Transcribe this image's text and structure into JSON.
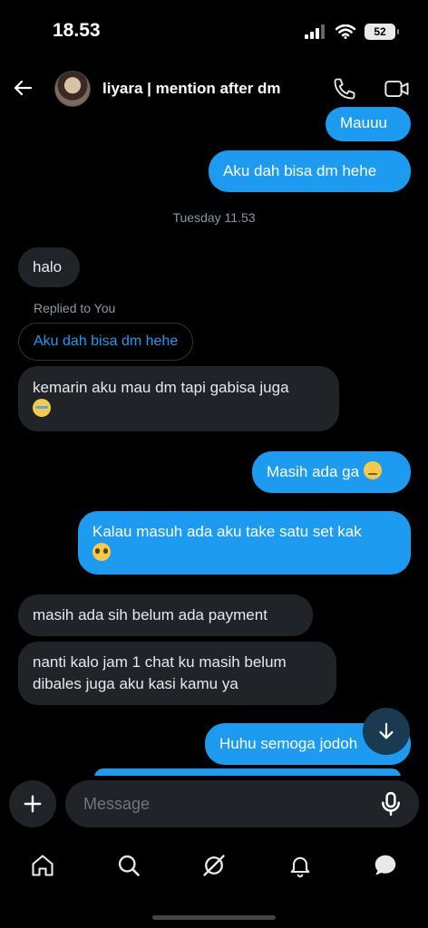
{
  "status_bar": {
    "time": "18.53",
    "battery": "52"
  },
  "header": {
    "contact_name": "liyara | mention after dm"
  },
  "timestamp": "Tuesday 11.53",
  "reply": {
    "label": "Replied to You",
    "quoted_text": "Aku dah bisa dm hehe"
  },
  "messages": [
    {
      "side": "out",
      "text": "Mauuu"
    },
    {
      "side": "out",
      "text": "Aku dah bisa dm hehe"
    },
    {
      "side": "in",
      "text": "halo"
    },
    {
      "side": "in",
      "text": "kemarin aku mau dm tapi gabisa juga",
      "emoji": "loudly-crying-face"
    },
    {
      "side": "out",
      "text": "Masih ada ga",
      "emoji": "pensive-face"
    },
    {
      "side": "out",
      "text": "Kalau masuh ada aku take satu set kak",
      "emoji": "pleading-face"
    },
    {
      "side": "in",
      "text": "masih ada sih belum ada payment"
    },
    {
      "side": "in",
      "text": "nanti kalo jam 1 chat ku masih belum dibales juga aku kasi kamu ya"
    },
    {
      "side": "out",
      "text": "Huhu semoga jodoh"
    }
  ],
  "composer": {
    "placeholder": "Message"
  },
  "icons": {
    "back": "arrow-left-icon",
    "call": "phone-icon",
    "video": "video-camera-icon",
    "scroll": "arrow-down-icon",
    "add": "plus-icon",
    "mic": "microphone-icon",
    "nav": [
      "home-icon",
      "search-icon",
      "grok-icon",
      "bell-icon",
      "messages-icon"
    ]
  },
  "colors": {
    "accent": "#1d9bf0",
    "incoming_bubble": "#202327",
    "background": "#000000"
  }
}
